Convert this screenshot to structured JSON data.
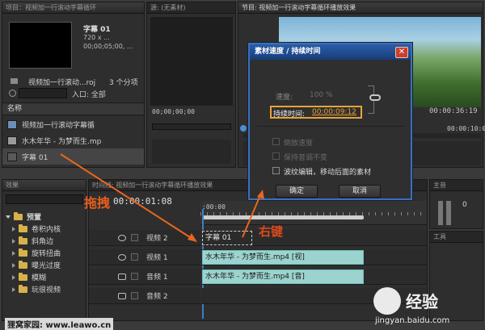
{
  "project_panel": {
    "tab": "项目：视频加一行滚动字幕循环",
    "preview_title": "字幕 01",
    "preview_info_1": "720 x ...",
    "preview_info_2": "00;00;05;00, ...",
    "project_name": "视频加一行滚动...roj",
    "item_count": "3 个分项",
    "entry_label": "入口: 全部",
    "name_header": "名称",
    "items": [
      {
        "label": "视频加一行滚动字幕循",
        "icon": "sequence-icon"
      },
      {
        "label": "水木年华 - 为梦而生.mp",
        "icon": "media-file-icon"
      },
      {
        "label": "字幕 01",
        "icon": "title-icon"
      }
    ]
  },
  "source_panel": {
    "tab": "源: (无素材)",
    "timecode": "00;00;00;00"
  },
  "program_panel": {
    "tab": "节目: 视频加一行滚动字幕循环播放效果",
    "timecode_right": "00:00:36:19",
    "ruler_label": "00:00:10:00"
  },
  "dialog": {
    "title": "素材速度 / 持续时间",
    "speed_label": "速度:",
    "speed_value": "100 %",
    "duration_label": "持续时间:",
    "duration_value": "00:00:09:12",
    "option_reverse": "倒放速度",
    "option_pitch": "保持音调不变",
    "option_ripple": "波纹编辑，移动后面的素材",
    "ok_label": "确定",
    "cancel_label": "取消"
  },
  "effects_panel": {
    "tab": "效果",
    "items": [
      {
        "label": "预置",
        "open": true
      },
      {
        "label": "卷积内核",
        "open": false
      },
      {
        "label": "斜角边",
        "open": false
      },
      {
        "label": "旋转扭曲",
        "open": false
      },
      {
        "label": "曝光过度",
        "open": false
      },
      {
        "label": "模糊",
        "open": false
      },
      {
        "label": "玩很视频",
        "open": false
      }
    ]
  },
  "timeline": {
    "tab": "时间线: 视频加一行滚动字幕循环播放效果",
    "timecode": "00:00:01:08",
    "ruler_start": ":00:00",
    "tracks": [
      {
        "name": "视频 2",
        "type": "video",
        "clip": "字幕 01"
      },
      {
        "name": "视频 1",
        "type": "video",
        "clip": "水木年华 - 为梦而生.mp4 [视]"
      },
      {
        "name": "音频 1",
        "type": "audio",
        "clip": "水木年华 - 为梦而生.mp4 [音]"
      },
      {
        "name": "音频 2",
        "type": "audio",
        "clip": ""
      }
    ]
  },
  "right_panels": {
    "master_label": "主音",
    "master_value": "0",
    "tools_label": "工具"
  },
  "annotations": {
    "drag": "拖拽",
    "right_click": "右键"
  },
  "watermark": {
    "site_left": "狸窝家园: www.leawo.cn",
    "logo_text": "经验",
    "logo_url": "jingyan.baidu.com"
  }
}
